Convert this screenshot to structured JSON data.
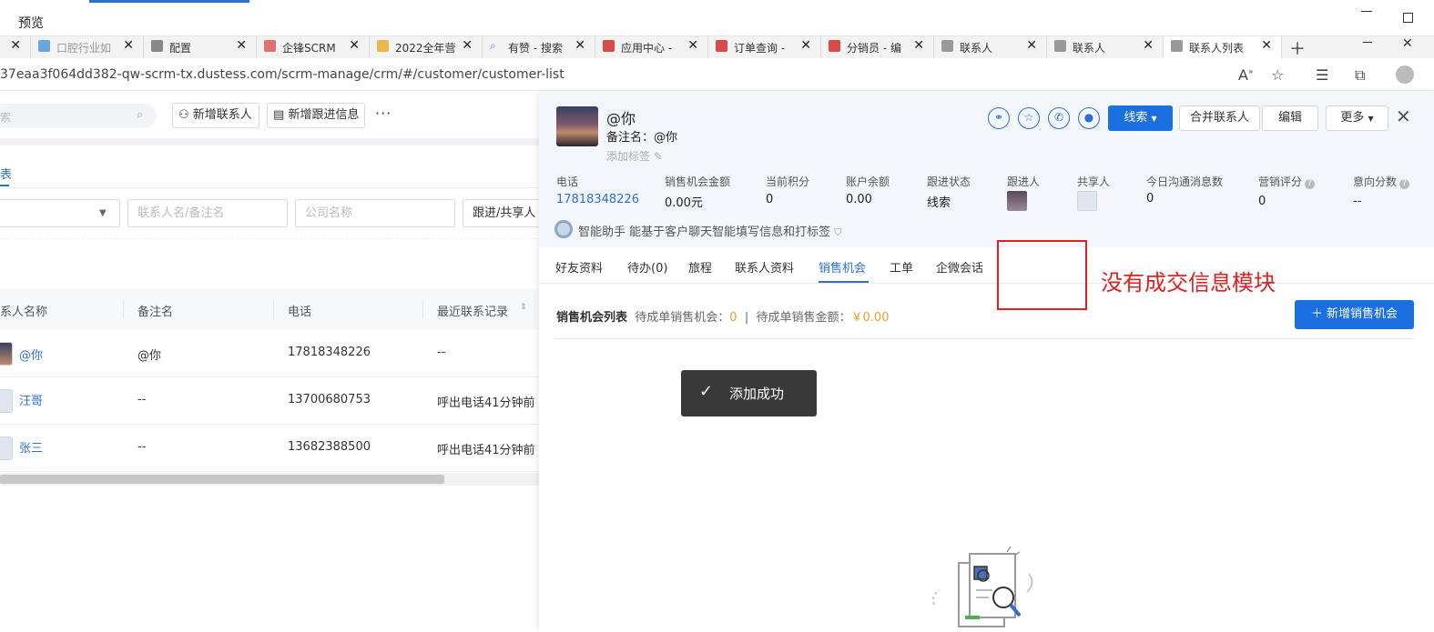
{
  "window": {
    "title": "预览"
  },
  "tabs": [
    {
      "label": "",
      "icon": "tab-icon",
      "active": false
    },
    {
      "label": "口腔行业如",
      "icon": "tab-icon",
      "active": false
    },
    {
      "label": "配置",
      "icon": "tab-icon",
      "active": false
    },
    {
      "label": "企锋SCRM",
      "icon": "tab-icon",
      "active": false
    },
    {
      "label": "2022全年营",
      "icon": "tab-icon",
      "active": false
    },
    {
      "label": "有赞 - 搜索",
      "icon": "search-icon",
      "active": false
    },
    {
      "label": "应用中心 -",
      "icon": "tab-icon",
      "active": false
    },
    {
      "label": "订单查询 -",
      "icon": "tab-icon",
      "active": false
    },
    {
      "label": "分销员 - 编",
      "icon": "tab-icon",
      "active": false
    },
    {
      "label": "联系人",
      "icon": "tab-icon",
      "active": false
    },
    {
      "label": "联系人",
      "icon": "tab-icon",
      "active": false
    },
    {
      "label": "联系人列表",
      "icon": "tab-icon",
      "active": true
    }
  ],
  "address": {
    "url": "37eaa3f064dd382-qw-scrm-tx.dustess.com/scrm-manage/crm/#/customer/customer-list"
  },
  "list": {
    "search_placeholder": "索",
    "add_contact": "新增联系人",
    "add_followup": "新增跟进信息",
    "more": "···",
    "tab_label": "表",
    "filters": {
      "contact_name": "联系人名/备注名",
      "company": "公司名称",
      "follow_share": "跟进/共享人"
    },
    "columns": {
      "name": "系人名称",
      "remark": "备注名",
      "phone": "电话",
      "last_contact": "最近联系记录"
    },
    "rows": [
      {
        "name": "@你",
        "remark": "@你",
        "phone": "17818348226",
        "last": "--"
      },
      {
        "name": "汪哥",
        "remark": "--",
        "phone": "13700680753",
        "last": "呼出电话41分钟前"
      },
      {
        "name": "张三",
        "remark": "--",
        "phone": "13682388500",
        "last": "呼出电话41分钟前"
      }
    ]
  },
  "drawer": {
    "name": "@你",
    "remark": "备注名：@你",
    "add_tag": "添加标签",
    "btn_lead": "线索",
    "btn_merge": "合并联系人",
    "btn_edit": "编辑",
    "btn_more": "更多",
    "stats": {
      "phone_label": "电话",
      "phone_value": "17818348226",
      "amount_label": "销售机会金额",
      "amount_value": "0.00元",
      "points_label": "当前积分",
      "points_value": "0",
      "balance_label": "账户余额",
      "balance_value": "0.00",
      "status_label": "跟进状态",
      "status_value": "线索",
      "follower_label": "跟进人",
      "sharer_label": "共享人",
      "msgs_label": "今日沟通消息数",
      "msgs_value": "0",
      "mkt_label": "营销评分",
      "mkt_value": "0",
      "intent_label": "意向分数",
      "intent_value": "--"
    },
    "ai_text": "智能助手 能基于客户聊天智能填写信息和打标签",
    "tabs": [
      "好友资料",
      "待办(0)",
      "旅程",
      "联系人资料",
      "销售机会",
      "工单",
      "企微会话"
    ],
    "active_tab": "销售机会",
    "opp_title": "销售机会列表",
    "opp_pending_label": "待成单销售机会：",
    "opp_pending_value": "0",
    "opp_sep": "|",
    "opp_amount_label": "待成单销售金额：",
    "opp_amount_value": "￥0.00",
    "btn_new_opp": "＋ 新增销售机会"
  },
  "annotation": {
    "text": "没有成交信息模块"
  },
  "toast": {
    "text": "添加成功"
  },
  "colors": {
    "accent": "#1b6fe0",
    "annotation_red": "#e02020",
    "amount_orange": "#f29a2e"
  }
}
